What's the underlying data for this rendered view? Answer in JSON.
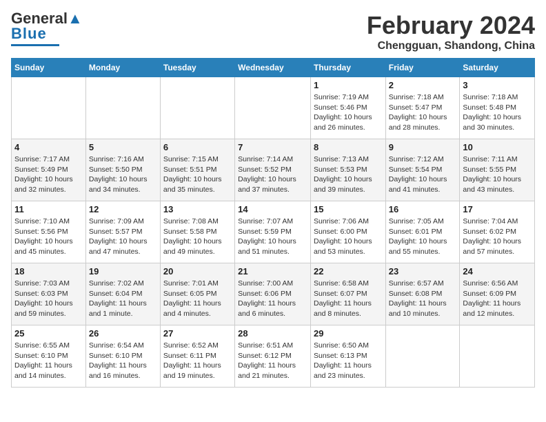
{
  "header": {
    "logo_general": "General",
    "logo_blue": "Blue",
    "month_title": "February 2024",
    "location": "Chengguan, Shandong, China"
  },
  "days_of_week": [
    "Sunday",
    "Monday",
    "Tuesday",
    "Wednesday",
    "Thursday",
    "Friday",
    "Saturday"
  ],
  "weeks": [
    {
      "days": [
        {
          "num": "",
          "info": "",
          "empty": true
        },
        {
          "num": "",
          "info": "",
          "empty": true
        },
        {
          "num": "",
          "info": "",
          "empty": true
        },
        {
          "num": "",
          "info": "",
          "empty": true
        },
        {
          "num": "1",
          "info": "Sunrise: 7:19 AM\nSunset: 5:46 PM\nDaylight: 10 hours\nand 26 minutes."
        },
        {
          "num": "2",
          "info": "Sunrise: 7:18 AM\nSunset: 5:47 PM\nDaylight: 10 hours\nand 28 minutes."
        },
        {
          "num": "3",
          "info": "Sunrise: 7:18 AM\nSunset: 5:48 PM\nDaylight: 10 hours\nand 30 minutes."
        }
      ]
    },
    {
      "days": [
        {
          "num": "4",
          "info": "Sunrise: 7:17 AM\nSunset: 5:49 PM\nDaylight: 10 hours\nand 32 minutes."
        },
        {
          "num": "5",
          "info": "Sunrise: 7:16 AM\nSunset: 5:50 PM\nDaylight: 10 hours\nand 34 minutes."
        },
        {
          "num": "6",
          "info": "Sunrise: 7:15 AM\nSunset: 5:51 PM\nDaylight: 10 hours\nand 35 minutes."
        },
        {
          "num": "7",
          "info": "Sunrise: 7:14 AM\nSunset: 5:52 PM\nDaylight: 10 hours\nand 37 minutes."
        },
        {
          "num": "8",
          "info": "Sunrise: 7:13 AM\nSunset: 5:53 PM\nDaylight: 10 hours\nand 39 minutes."
        },
        {
          "num": "9",
          "info": "Sunrise: 7:12 AM\nSunset: 5:54 PM\nDaylight: 10 hours\nand 41 minutes."
        },
        {
          "num": "10",
          "info": "Sunrise: 7:11 AM\nSunset: 5:55 PM\nDaylight: 10 hours\nand 43 minutes."
        }
      ]
    },
    {
      "days": [
        {
          "num": "11",
          "info": "Sunrise: 7:10 AM\nSunset: 5:56 PM\nDaylight: 10 hours\nand 45 minutes."
        },
        {
          "num": "12",
          "info": "Sunrise: 7:09 AM\nSunset: 5:57 PM\nDaylight: 10 hours\nand 47 minutes."
        },
        {
          "num": "13",
          "info": "Sunrise: 7:08 AM\nSunset: 5:58 PM\nDaylight: 10 hours\nand 49 minutes."
        },
        {
          "num": "14",
          "info": "Sunrise: 7:07 AM\nSunset: 5:59 PM\nDaylight: 10 hours\nand 51 minutes."
        },
        {
          "num": "15",
          "info": "Sunrise: 7:06 AM\nSunset: 6:00 PM\nDaylight: 10 hours\nand 53 minutes."
        },
        {
          "num": "16",
          "info": "Sunrise: 7:05 AM\nSunset: 6:01 PM\nDaylight: 10 hours\nand 55 minutes."
        },
        {
          "num": "17",
          "info": "Sunrise: 7:04 AM\nSunset: 6:02 PM\nDaylight: 10 hours\nand 57 minutes."
        }
      ]
    },
    {
      "days": [
        {
          "num": "18",
          "info": "Sunrise: 7:03 AM\nSunset: 6:03 PM\nDaylight: 10 hours\nand 59 minutes."
        },
        {
          "num": "19",
          "info": "Sunrise: 7:02 AM\nSunset: 6:04 PM\nDaylight: 11 hours\nand 1 minute."
        },
        {
          "num": "20",
          "info": "Sunrise: 7:01 AM\nSunset: 6:05 PM\nDaylight: 11 hours\nand 4 minutes."
        },
        {
          "num": "21",
          "info": "Sunrise: 7:00 AM\nSunset: 6:06 PM\nDaylight: 11 hours\nand 6 minutes."
        },
        {
          "num": "22",
          "info": "Sunrise: 6:58 AM\nSunset: 6:07 PM\nDaylight: 11 hours\nand 8 minutes."
        },
        {
          "num": "23",
          "info": "Sunrise: 6:57 AM\nSunset: 6:08 PM\nDaylight: 11 hours\nand 10 minutes."
        },
        {
          "num": "24",
          "info": "Sunrise: 6:56 AM\nSunset: 6:09 PM\nDaylight: 11 hours\nand 12 minutes."
        }
      ]
    },
    {
      "days": [
        {
          "num": "25",
          "info": "Sunrise: 6:55 AM\nSunset: 6:10 PM\nDaylight: 11 hours\nand 14 minutes."
        },
        {
          "num": "26",
          "info": "Sunrise: 6:54 AM\nSunset: 6:10 PM\nDaylight: 11 hours\nand 16 minutes."
        },
        {
          "num": "27",
          "info": "Sunrise: 6:52 AM\nSunset: 6:11 PM\nDaylight: 11 hours\nand 19 minutes."
        },
        {
          "num": "28",
          "info": "Sunrise: 6:51 AM\nSunset: 6:12 PM\nDaylight: 11 hours\nand 21 minutes."
        },
        {
          "num": "29",
          "info": "Sunrise: 6:50 AM\nSunset: 6:13 PM\nDaylight: 11 hours\nand 23 minutes."
        },
        {
          "num": "",
          "info": "",
          "empty": true
        },
        {
          "num": "",
          "info": "",
          "empty": true
        }
      ]
    }
  ]
}
